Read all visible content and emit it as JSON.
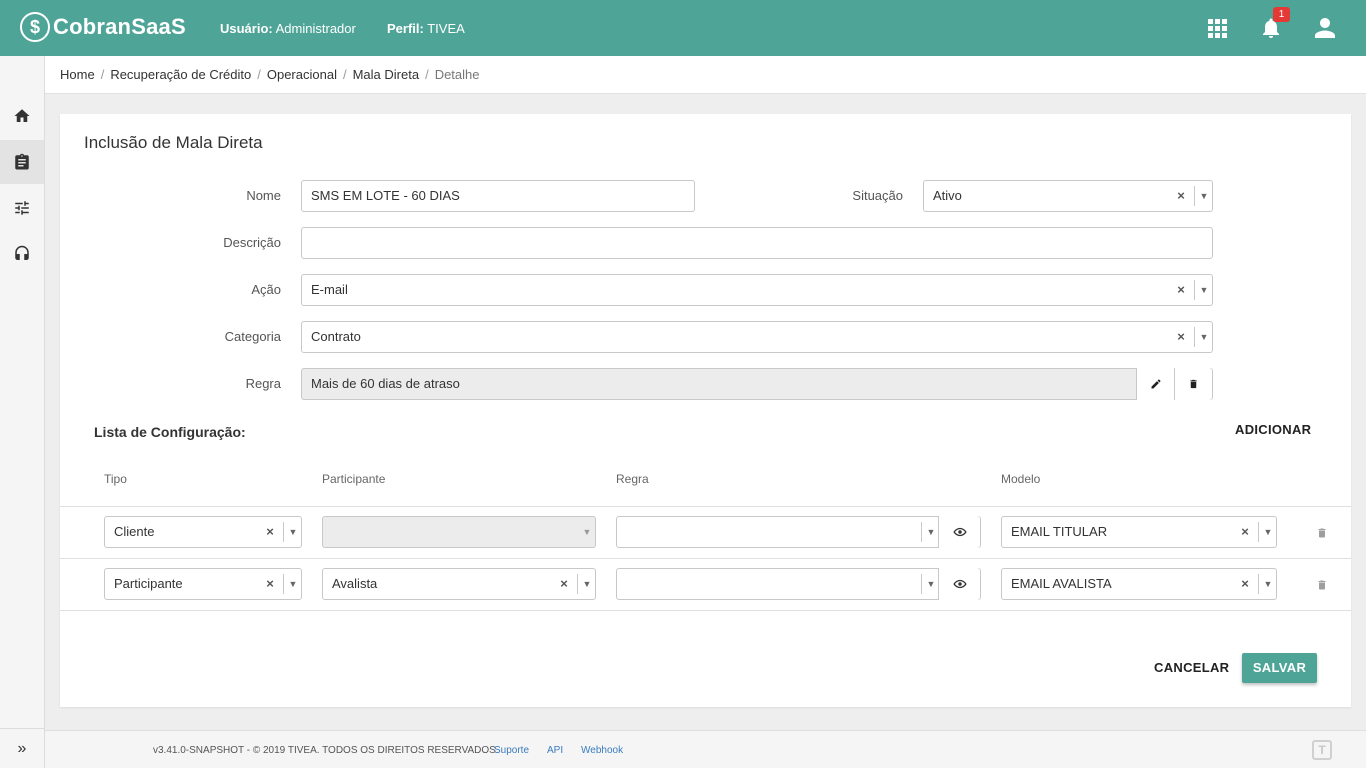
{
  "header": {
    "logo_mark": "$",
    "app_name": "CobranSaaS",
    "user_label": "Usuário:",
    "user_value": "Administrador",
    "profile_label": "Perfil:",
    "profile_value": "TIVEA",
    "notification_count": "1",
    "color": "#4ea597"
  },
  "sidebar": {
    "items": [
      {
        "icon": "home-icon"
      },
      {
        "icon": "clipboard-icon",
        "active": true
      },
      {
        "icon": "sliders-icon"
      },
      {
        "icon": "headset-icon"
      }
    ],
    "expand_glyph": "»"
  },
  "breadcrumb": {
    "items": [
      "Home",
      "Recuperação de Crédito",
      "Operacional",
      "Mala Direta"
    ],
    "current": "Detalhe",
    "separator": "/"
  },
  "form": {
    "title": "Inclusão de Mala Direta",
    "nome_label": "Nome",
    "nome_value": "SMS EM LOTE - 60 DIAS",
    "situacao_label": "Situação",
    "situacao_value": "Ativo",
    "descricao_label": "Descrição",
    "descricao_value": "",
    "acao_label": "Ação",
    "acao_value": "E-mail",
    "categoria_label": "Categoria",
    "categoria_value": "Contrato",
    "regra_label": "Regra",
    "regra_value": "Mais de 60 dias de atraso"
  },
  "config": {
    "title": "Lista de Configuração:",
    "add_label": "ADICIONAR",
    "columns": [
      "Tipo",
      "Participante",
      "Regra",
      "Modelo"
    ],
    "rows": [
      {
        "tipo": "Cliente",
        "participante": "",
        "participante_disabled": true,
        "regra": "",
        "modelo": "EMAIL TITULAR"
      },
      {
        "tipo": "Participante",
        "participante": "Avalista",
        "participante_disabled": false,
        "regra": "",
        "modelo": "EMAIL AVALISTA"
      }
    ]
  },
  "actions": {
    "cancel_label": "CANCELAR",
    "save_label": "SALVAR"
  },
  "footer": {
    "copyright": "v3.41.0-SNAPSHOT - © 2019 TIVEA. TODOS OS DIREITOS RESERVADOS.",
    "links": [
      "Suporte",
      "API",
      "Webhook"
    ],
    "logo_glyph": "T"
  }
}
